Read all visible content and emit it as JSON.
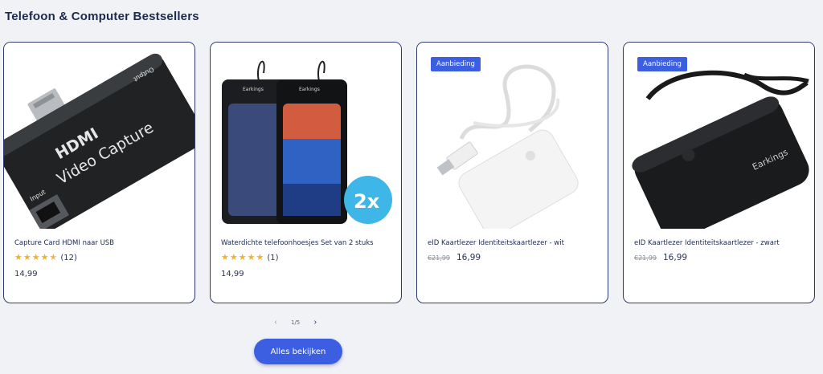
{
  "section": {
    "title": "Telefoon & Computer Bestsellers"
  },
  "colors": {
    "accent": "#3b5fe0",
    "star": "#f0b22c",
    "card_border": "#2d3a6b",
    "heading": "#1c2a4d"
  },
  "products": [
    {
      "title": "Capture Card HDMI naar USB",
      "image_text": {
        "brand": "HDMI",
        "product": "Video Capture",
        "port_in": "Input",
        "port_out": "Output"
      },
      "rating": 4.5,
      "reviews": "(12)",
      "price": "14,99"
    },
    {
      "title": "Waterdichte telefoonhoesjes Set van 2 stuks",
      "image_text": {
        "brand": "Earkings",
        "multiplier": "2x"
      },
      "rating": 5,
      "reviews": "(1)",
      "price": "14,99"
    },
    {
      "title": "eID Kaartlezer Identiteitskaartlezer - wit",
      "badge": "Aanbieding",
      "old_price": "€21,99",
      "price": "16,99"
    },
    {
      "title": "eID Kaartlezer Identiteitskaartlezer - zwart",
      "badge": "Aanbieding",
      "image_text": {
        "brand": "Earkings"
      },
      "old_price": "€21,99",
      "price": "16,99"
    }
  ],
  "pagination": {
    "prev_icon": "chevron-left-icon",
    "text": "1/5",
    "next_icon": "chevron-right-icon"
  },
  "view_all": {
    "label": "Alles bekijken"
  }
}
